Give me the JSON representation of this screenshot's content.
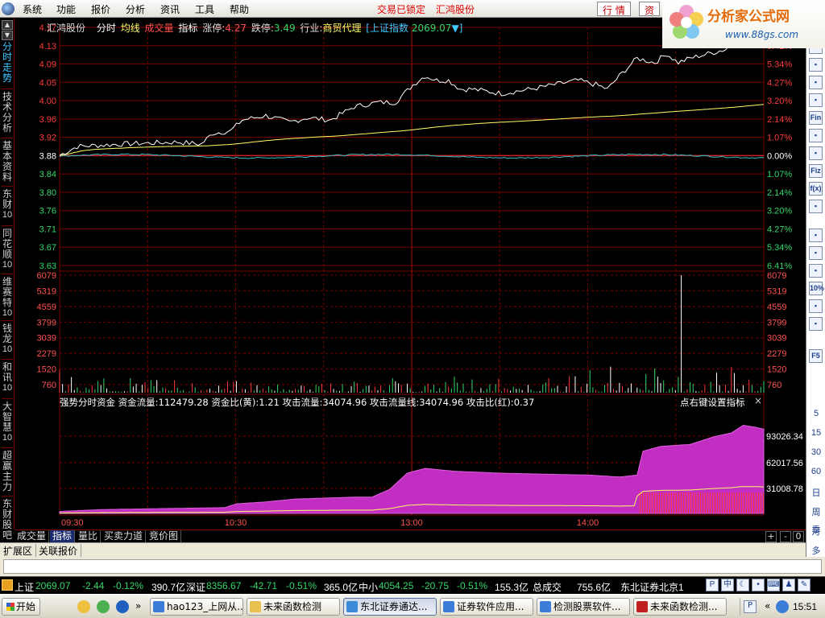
{
  "menubar": {
    "items": [
      "系统",
      "功能",
      "报价",
      "分析",
      "资讯",
      "工具",
      "帮助"
    ],
    "status_locked": "交易已锁定",
    "stock_name": "汇鸿股份",
    "btn_quote": "行 情",
    "btn_info": "资"
  },
  "banner": {
    "title": "分析家公式网",
    "url": "www.88gs.com",
    "small": "锁"
  },
  "left_tabs": [
    {
      "chars": [
        "分",
        "时",
        "走",
        "势"
      ],
      "num": ""
    },
    {
      "chars": [
        "技",
        "术",
        "分",
        "析"
      ],
      "num": ""
    },
    {
      "chars": [
        "基",
        "本",
        "资",
        "料"
      ],
      "num": ""
    },
    {
      "chars": [
        "东",
        "财"
      ],
      "num": "10"
    },
    {
      "chars": [
        "同",
        "花",
        "顺"
      ],
      "num": "10"
    },
    {
      "chars": [
        "维",
        "赛",
        "特"
      ],
      "num": "10"
    },
    {
      "chars": [
        "钱",
        "龙"
      ],
      "num": "10"
    },
    {
      "chars": [
        "和",
        "讯"
      ],
      "num": "10"
    },
    {
      "chars": [
        "大",
        "智",
        "慧"
      ],
      "num": "10"
    },
    {
      "chars": [
        "超",
        "赢",
        "主",
        "力"
      ],
      "num": ""
    },
    {
      "chars": [
        "东",
        "财",
        "股",
        "吧"
      ],
      "num": ""
    }
  ],
  "header": {
    "stock": "汇鸿股份",
    "t_fenshi": "分时",
    "t_junxian": "均线",
    "t_chengjiao": "成交量",
    "t_zhibiao": "指标",
    "zt_label": "涨停:",
    "zt_value": "4.27",
    "dt_label": "跌停:",
    "dt_value": "3.49",
    "industry_label": "行业:",
    "industry": "商贸代理",
    "index_name": "[上证指数",
    "index_value": "2069.07",
    "index_arrow": "▼]"
  },
  "price_ticks": [
    {
      "v": "4.17",
      "p": "6.41%",
      "up": true
    },
    {
      "v": "4.13",
      "p": "6.41%",
      "up": true
    },
    {
      "v": "4.09",
      "p": "5.34%",
      "up": true
    },
    {
      "v": "4.05",
      "p": "4.27%",
      "up": true
    },
    {
      "v": "4.00",
      "p": "3.20%",
      "up": true
    },
    {
      "v": "3.96",
      "p": "2.14%",
      "up": true
    },
    {
      "v": "3.92",
      "p": "1.07%",
      "up": true
    },
    {
      "v": "3.88",
      "p": "0.00%",
      "up": null
    },
    {
      "v": "3.84",
      "p": "1.07%",
      "up": false
    },
    {
      "v": "3.80",
      "p": "2.14%",
      "up": false
    },
    {
      "v": "3.76",
      "p": "3.20%",
      "up": false
    },
    {
      "v": "3.71",
      "p": "4.27%",
      "up": false
    },
    {
      "v": "3.67",
      "p": "5.34%",
      "up": false
    },
    {
      "v": "3.63",
      "p": "6.41%",
      "up": false
    }
  ],
  "volume_ticks": [
    "6079",
    "5319",
    "4559",
    "3799",
    "3039",
    "2279",
    "1520",
    "760"
  ],
  "indicator": {
    "name": "强势分时资金",
    "flow_label": "资金流量:",
    "flow": "112479.28",
    "ratio_label": "资金比(黄):",
    "ratio": "1.21",
    "attack_label": "攻击流量:",
    "attack": "34074.96",
    "attack_line_label": "攻击流量线:",
    "attack_line": "34074.96",
    "attack_ratio_label": "攻击比(红):",
    "attack_ratio": "0.37",
    "hint": "点右键设置指标",
    "close": "×",
    "ticks": [
      "93026.34",
      "62017.56",
      "31008.78"
    ]
  },
  "time_ticks": [
    "09:30",
    "10:30",
    "13:00",
    "14:00"
  ],
  "bottom_tabs": [
    "成交量",
    "指标",
    "量比",
    "买卖力道",
    "竞价图"
  ],
  "bottom_buttons": [
    "+",
    "-",
    "0"
  ],
  "ext_tabs": [
    "扩展区",
    "关联报价"
  ],
  "right_side": {
    "labels": [
      "Fin",
      "Fiz",
      "f(x)",
      "10%",
      "F5",
      "5",
      "15",
      "30",
      "60",
      "日",
      "周",
      "月",
      "多",
      "季"
    ]
  },
  "index_bar": {
    "sh_label": "上证",
    "sh_value": "2069.07",
    "sh_change": "-2.44",
    "sh_pct": "-0.12%",
    "sh_amount": "390.7亿",
    "sz_label": "深证",
    "sz_value": "8356.67",
    "sz_change": "-42.71",
    "sz_pct": "-0.51%",
    "sz_amount": "365.0亿",
    "zx_label": "中小",
    "zx_value": "4054.25",
    "zx_change": "-20.75",
    "zx_pct": "-0.51%",
    "zx_amount": "155.3亿",
    "total_label": "总成交",
    "total_value": "755.6亿",
    "broker": "东北证券北京1",
    "ime": "中"
  },
  "taskbar": {
    "start": "开始",
    "tasks": [
      "hao123_上网从...",
      "未来函数检测",
      "东北证券通达...",
      "证券软件应用...",
      "检测股票软件...",
      "未来函数检测..."
    ],
    "clock": "15:51"
  },
  "colors": {
    "bg": "#000000",
    "grid": "#7a0000",
    "up": "#ff3b3b",
    "down": "#33d66b",
    "price_line": "#ffffff",
    "avg_line": "#ffff66",
    "index_line": "#33c0c8",
    "magenta": "#c22dc2",
    "axis_text": "#ff5050"
  }
}
